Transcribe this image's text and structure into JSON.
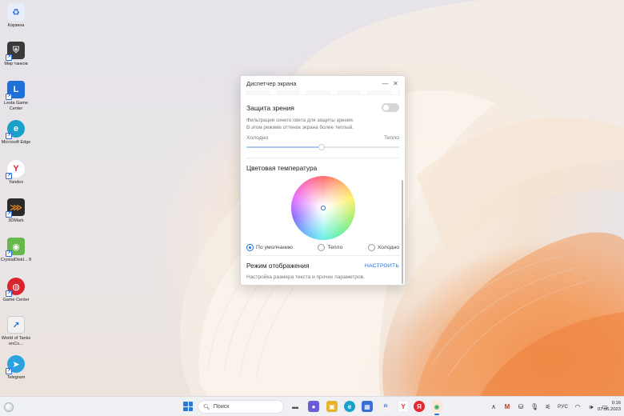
{
  "desktop": {
    "icons": [
      {
        "name": "recycle-bin",
        "label": "Корзина",
        "color": "#e8eef9",
        "glyph": "♻",
        "glyph_color": "#2b6cd9"
      },
      {
        "name": "world-of-tanks",
        "label": "Мир танков",
        "color": "#3a3a3a",
        "glyph": "⛨",
        "glyph_color": "#d9d9d9"
      },
      {
        "name": "lesta-game-center",
        "label": "Lesta Game Center",
        "color": "#1f6fd8",
        "glyph": "L",
        "glyph_color": "#ffffff"
      },
      {
        "name": "microsoft-edge",
        "label": "Microsoft Edge",
        "color": "#1aa1c9",
        "glyph": "e",
        "glyph_color": "#ffffff"
      },
      {
        "name": "yandex",
        "label": "Yandex",
        "color": "#ffffff",
        "glyph": "Y",
        "glyph_color": "#e4282f"
      },
      {
        "name": "3dmark",
        "label": "3DMark",
        "color": "#2a2a2a",
        "glyph": "⋙",
        "glyph_color": "#f08a1c"
      },
      {
        "name": "crystaldiskinfo",
        "label": "CrystalDiskI... 8",
        "color": "#66b84a",
        "glyph": "◉",
        "glyph_color": "#ffffff"
      },
      {
        "name": "game-center",
        "label": "Game Center",
        "color": "#d9232d",
        "glyph": "◍",
        "glyph_color": "#ffffff"
      },
      {
        "name": "world-of-tanks-enco",
        "label": "World of Tanks enCo...",
        "color": "#f2f2f2",
        "glyph": "↗",
        "glyph_color": "#2b6cd9"
      },
      {
        "name": "telegram",
        "label": "Telegram",
        "color": "#2aa3e0",
        "glyph": "➤",
        "glyph_color": "#ffffff"
      }
    ]
  },
  "window": {
    "title": "Диспетчер экрана",
    "minimize": "—",
    "close": "✕",
    "eye_protection": {
      "label": "Защита зрения",
      "enabled": false,
      "description_line1": "Фильтрация синего света для защиты зрения.",
      "description_line2": "В этом режиме оттенок экрана более теплый.",
      "cold_label": "Холодно",
      "warm_label": "Тепло",
      "slider_value": 0.49
    },
    "color_temperature": {
      "label": "Цветовая температура",
      "options": [
        {
          "label": "По умолчанию",
          "selected": true
        },
        {
          "label": "Тепло",
          "selected": false
        },
        {
          "label": "Холодно",
          "selected": false
        }
      ]
    },
    "display_mode": {
      "label": "Режим отображения",
      "action": "НАСТРОИТЬ",
      "description": "Настройка размера текста и прочих параметров."
    }
  },
  "taskbar": {
    "search_placeholder": "Поиск",
    "apps": [
      {
        "name": "file-explorer",
        "glyph": "▬",
        "color": "#f2c14e"
      },
      {
        "name": "chat",
        "glyph": "●",
        "color": "#6b5bd6"
      },
      {
        "name": "explorer",
        "glyph": "▣",
        "color": "#e6b42b"
      },
      {
        "name": "edge",
        "glyph": "e",
        "color": "#1aa1c9"
      },
      {
        "name": "store",
        "glyph": "▦",
        "color": "#3a6fd6"
      },
      {
        "name": "task-manager",
        "glyph": "ılı",
        "color": "#3a6fd6"
      },
      {
        "name": "yandex-browser",
        "glyph": "Y",
        "color": "#ffffff"
      },
      {
        "name": "yandex",
        "glyph": "Я",
        "color": "#e4282f"
      },
      {
        "name": "chrome",
        "glyph": "◉",
        "color": "#34a853"
      }
    ],
    "tray": {
      "chevron": "∧",
      "language": "РУС",
      "time": "0:16",
      "date": "07.06.2023"
    }
  }
}
